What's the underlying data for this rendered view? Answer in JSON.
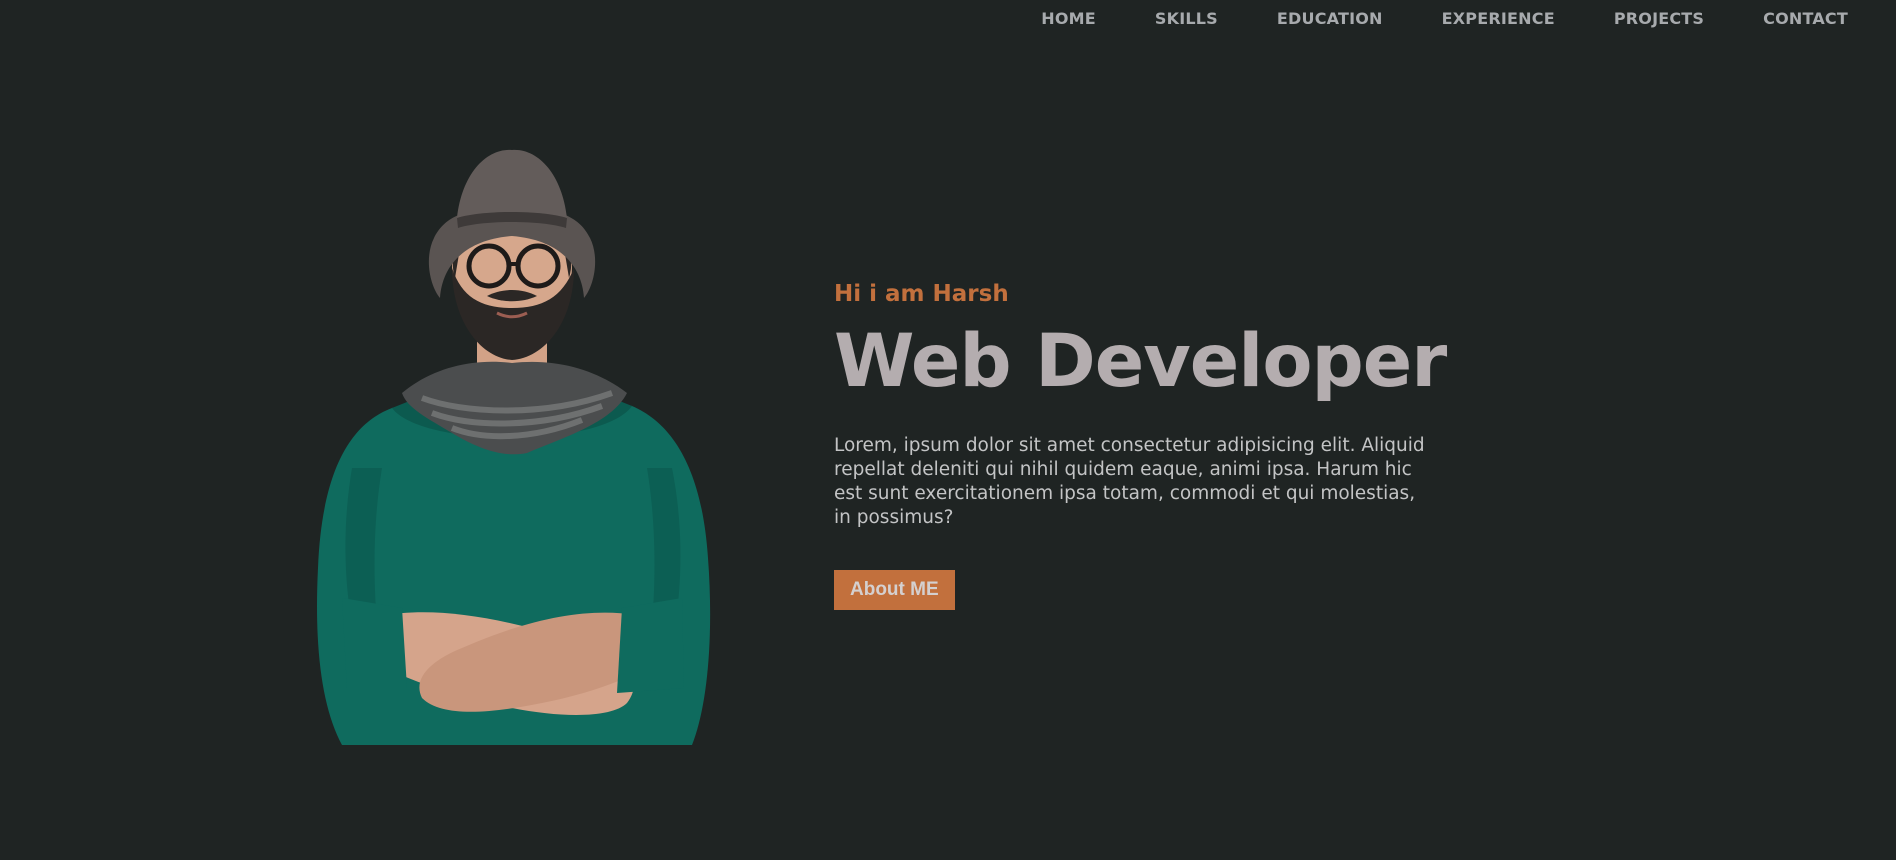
{
  "nav": {
    "items": [
      "HOME",
      "SKILLS",
      "EDUCATION",
      "EXPERIENCE",
      "PROJECTS",
      "CONTACT"
    ]
  },
  "hero": {
    "greeting": "Hi i am Harsh",
    "headline": "Web Developer",
    "description": "Lorem, ipsum dolor sit amet consectetur adipisicing elit. Aliquid repellat deleniti qui nihil quidem eaque, animi ipsa. Harum hic est sunt exercitationem ipsa totam, commodi et qui molestias, in possimus?",
    "button_label": "About ME"
  },
  "colors": {
    "background": "#1f2423",
    "accent": "#c2703d",
    "headline": "#b4adaf",
    "nav_text": "#a7aaad"
  }
}
